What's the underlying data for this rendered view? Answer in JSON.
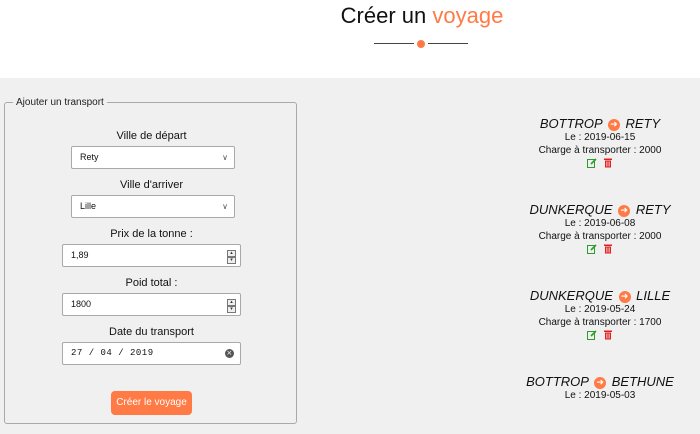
{
  "header": {
    "title_part1": "Créer un",
    "title_accent": "voyage"
  },
  "colors": {
    "accent": "#ff7a45",
    "edit": "#2a9d2a",
    "delete": "#e02020",
    "panel_bg": "#f0f0f0"
  },
  "form": {
    "legend": "Ajouter un transport",
    "departure": {
      "label": "Ville de départ",
      "value": "Rety"
    },
    "arrival": {
      "label": "Ville d'arriver",
      "value": "Lille"
    },
    "price": {
      "label": "Prix de la tonne :",
      "value": "1,89"
    },
    "weight": {
      "label": "Poid total :",
      "value": "1800"
    },
    "date": {
      "label": "Date du transport",
      "value": "27 / 04 / 2019"
    },
    "submit_label": "Créer le voyage"
  },
  "icons": {
    "arrow": "arrow-right-circle-icon",
    "edit": "edit-icon",
    "delete": "trash-icon",
    "clear": "clear-icon",
    "dropdown": "chevron-down-icon"
  },
  "trips": [
    {
      "from": "BOTTROP",
      "to": "RETY",
      "date": "Le : 2019-06-15",
      "charge": "Charge à transporter : 2000"
    },
    {
      "from": "DUNKERQUE",
      "to": "RETY",
      "date": "Le : 2019-06-08",
      "charge": "Charge à transporter : 2000"
    },
    {
      "from": "DUNKERQUE",
      "to": "LILLE",
      "date": "Le : 2019-05-24",
      "charge": "Charge à transporter : 1700"
    },
    {
      "from": "BOTTROP",
      "to": "BETHUNE",
      "date": "Le : 2019-05-03",
      "charge": ""
    }
  ]
}
